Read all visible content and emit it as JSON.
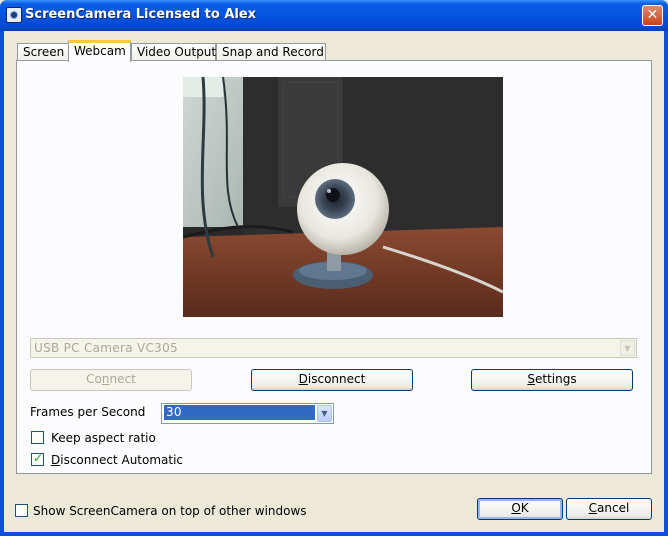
{
  "window": {
    "title": "ScreenCamera Licensed to Alex",
    "close_glyph": "✕"
  },
  "tabs": [
    {
      "label": "Screen",
      "active": false
    },
    {
      "label": "Webcam",
      "active": true
    },
    {
      "label": "Video Output",
      "active": false
    },
    {
      "label": "Snap and Record",
      "active": false
    }
  ],
  "webcam": {
    "device": {
      "value": "USB PC Camera VC305",
      "enabled": false
    },
    "buttons": {
      "connect": {
        "pre": "Co",
        "key": "n",
        "post": "nect",
        "enabled": false
      },
      "disconnect": {
        "pre": "",
        "key": "D",
        "post": "isconnect"
      },
      "settings": {
        "pre": "",
        "key": "S",
        "post": "ettings"
      }
    },
    "fps": {
      "label": "Frames per Second",
      "value": "30"
    },
    "keep_aspect": {
      "label": "Keep aspect ratio",
      "checked": false
    },
    "disconnect_auto": {
      "pre": "",
      "key": "D",
      "post": "isconnect Automatic",
      "checked": true
    }
  },
  "footer": {
    "on_top": {
      "label": "Show ScreenCamera on top of other windows",
      "checked": false
    },
    "ok": {
      "pre": "",
      "key": "O",
      "post": "K"
    },
    "cancel": {
      "pre": "",
      "key": "C",
      "post": "ancel"
    }
  },
  "icons": {
    "app": "webcam-app-icon",
    "dropdown": "chevron-down-icon",
    "check": "checkmark-icon"
  },
  "colors": {
    "titlebar": "#0553e0",
    "selected_fps_bg": "#316ac5",
    "active_tab_accent": "#ffc83c"
  }
}
